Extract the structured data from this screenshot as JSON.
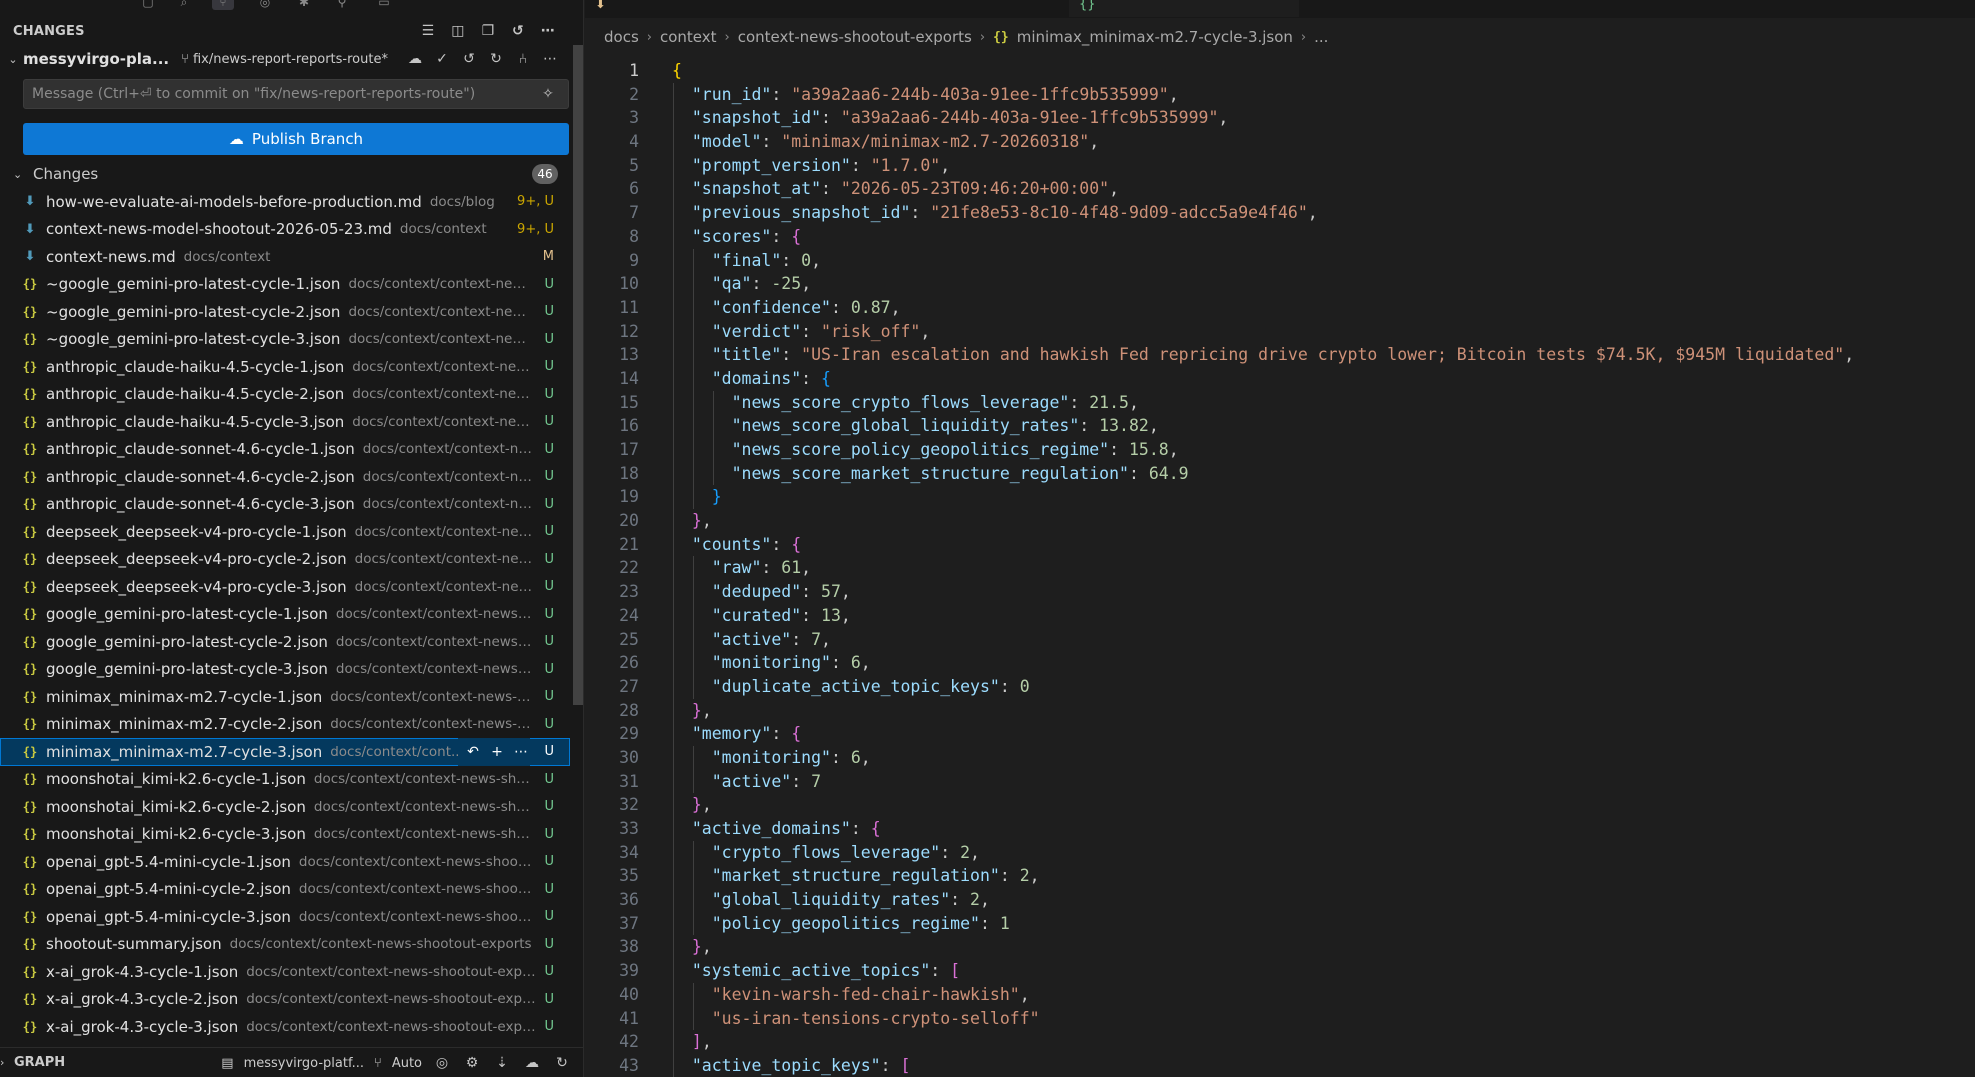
{
  "sidebar": {
    "changes_title": "CHANGES",
    "repo_name": "messyvirgo-pla...",
    "branch": "fix/news-report-reports-route*",
    "commit_placeholder": "Message (Ctrl+⏎ to commit on \"fix/news-report-reports-route\")",
    "publish_label": "Publish Branch",
    "changes_group_label": "Changes",
    "changes_count": "46",
    "files": [
      {
        "name": "how-we-evaluate-ai-models-before-production.md",
        "path": "docs/blog",
        "status": "9+, U",
        "kind": "md"
      },
      {
        "name": "context-news-model-shootout-2026-05-23.md",
        "path": "docs/context",
        "status": "9+, U",
        "kind": "md"
      },
      {
        "name": "context-news.md",
        "path": "docs/context",
        "status": "M",
        "kind": "md"
      },
      {
        "name": "~google_gemini-pro-latest-cycle-1.json",
        "path": "docs/context/context-news...",
        "status": "U",
        "kind": "json"
      },
      {
        "name": "~google_gemini-pro-latest-cycle-2.json",
        "path": "docs/context/context-news...",
        "status": "U",
        "kind": "json"
      },
      {
        "name": "~google_gemini-pro-latest-cycle-3.json",
        "path": "docs/context/context-news...",
        "status": "U",
        "kind": "json"
      },
      {
        "name": "anthropic_claude-haiku-4.5-cycle-1.json",
        "path": "docs/context/context-new...",
        "status": "U",
        "kind": "json"
      },
      {
        "name": "anthropic_claude-haiku-4.5-cycle-2.json",
        "path": "docs/context/context-new...",
        "status": "U",
        "kind": "json"
      },
      {
        "name": "anthropic_claude-haiku-4.5-cycle-3.json",
        "path": "docs/context/context-new...",
        "status": "U",
        "kind": "json"
      },
      {
        "name": "anthropic_claude-sonnet-4.6-cycle-1.json",
        "path": "docs/context/context-ne...",
        "status": "U",
        "kind": "json"
      },
      {
        "name": "anthropic_claude-sonnet-4.6-cycle-2.json",
        "path": "docs/context/context-ne...",
        "status": "U",
        "kind": "json"
      },
      {
        "name": "anthropic_claude-sonnet-4.6-cycle-3.json",
        "path": "docs/context/context-ne...",
        "status": "U",
        "kind": "json"
      },
      {
        "name": "deepseek_deepseek-v4-pro-cycle-1.json",
        "path": "docs/context/context-new...",
        "status": "U",
        "kind": "json"
      },
      {
        "name": "deepseek_deepseek-v4-pro-cycle-2.json",
        "path": "docs/context/context-new...",
        "status": "U",
        "kind": "json"
      },
      {
        "name": "deepseek_deepseek-v4-pro-cycle-3.json",
        "path": "docs/context/context-new...",
        "status": "U",
        "kind": "json"
      },
      {
        "name": "google_gemini-pro-latest-cycle-1.json",
        "path": "docs/context/context-news-s...",
        "status": "U",
        "kind": "json"
      },
      {
        "name": "google_gemini-pro-latest-cycle-2.json",
        "path": "docs/context/context-news-s...",
        "status": "U",
        "kind": "json"
      },
      {
        "name": "google_gemini-pro-latest-cycle-3.json",
        "path": "docs/context/context-news-s...",
        "status": "U",
        "kind": "json"
      },
      {
        "name": "minimax_minimax-m2.7-cycle-1.json",
        "path": "docs/context/context-news-s...",
        "status": "U",
        "kind": "json"
      },
      {
        "name": "minimax_minimax-m2.7-cycle-2.json",
        "path": "docs/context/context-news-s...",
        "status": "U",
        "kind": "json"
      },
      {
        "name": "minimax_minimax-m2.7-cycle-3.json",
        "path": "docs/context/cont...",
        "status": "U",
        "kind": "json",
        "selected": true
      },
      {
        "name": "moonshotai_kimi-k2.6-cycle-1.json",
        "path": "docs/context/context-news-sho...",
        "status": "U",
        "kind": "json"
      },
      {
        "name": "moonshotai_kimi-k2.6-cycle-2.json",
        "path": "docs/context/context-news-sho...",
        "status": "U",
        "kind": "json"
      },
      {
        "name": "moonshotai_kimi-k2.6-cycle-3.json",
        "path": "docs/context/context-news-sho...",
        "status": "U",
        "kind": "json"
      },
      {
        "name": "openai_gpt-5.4-mini-cycle-1.json",
        "path": "docs/context/context-news-shoot...",
        "status": "U",
        "kind": "json"
      },
      {
        "name": "openai_gpt-5.4-mini-cycle-2.json",
        "path": "docs/context/context-news-shoot...",
        "status": "U",
        "kind": "json"
      },
      {
        "name": "openai_gpt-5.4-mini-cycle-3.json",
        "path": "docs/context/context-news-shoot...",
        "status": "U",
        "kind": "json"
      },
      {
        "name": "shootout-summary.json",
        "path": "docs/context/context-news-shootout-exports",
        "status": "U",
        "kind": "json"
      },
      {
        "name": "x-ai_grok-4.3-cycle-1.json",
        "path": "docs/context/context-news-shootout-expo...",
        "status": "U",
        "kind": "json"
      },
      {
        "name": "x-ai_grok-4.3-cycle-2.json",
        "path": "docs/context/context-news-shootout-expo...",
        "status": "U",
        "kind": "json"
      },
      {
        "name": "x-ai_grok-4.3-cycle-3.json",
        "path": "docs/context/context-news-shootout-expo...",
        "status": "U",
        "kind": "json"
      }
    ],
    "graph_title": "GRAPH",
    "graph_repo": "messyvirgo-platf...",
    "graph_auto": "Auto"
  },
  "editor": {
    "breadcrumb": [
      "docs",
      "context",
      "context-news-shootout-exports",
      "minimax_minimax-m2.7-cycle-3.json",
      "..."
    ],
    "code_lines": [
      [
        [
          "b1",
          "{"
        ]
      ],
      [
        [
          "p",
          "  "
        ],
        [
          "k",
          "\"run_id\""
        ],
        [
          "p",
          ": "
        ],
        [
          "s",
          "\"a39a2aa6-244b-403a-91ee-1ffc9b535999\""
        ],
        [
          "p",
          ","
        ]
      ],
      [
        [
          "p",
          "  "
        ],
        [
          "k",
          "\"snapshot_id\""
        ],
        [
          "p",
          ": "
        ],
        [
          "s",
          "\"a39a2aa6-244b-403a-91ee-1ffc9b535999\""
        ],
        [
          "p",
          ","
        ]
      ],
      [
        [
          "p",
          "  "
        ],
        [
          "k",
          "\"model\""
        ],
        [
          "p",
          ": "
        ],
        [
          "s",
          "\"minimax/minimax-m2.7-20260318\""
        ],
        [
          "p",
          ","
        ]
      ],
      [
        [
          "p",
          "  "
        ],
        [
          "k",
          "\"prompt_version\""
        ],
        [
          "p",
          ": "
        ],
        [
          "s",
          "\"1.7.0\""
        ],
        [
          "p",
          ","
        ]
      ],
      [
        [
          "p",
          "  "
        ],
        [
          "k",
          "\"snapshot_at\""
        ],
        [
          "p",
          ": "
        ],
        [
          "s",
          "\"2026-05-23T09:46:20+00:00\""
        ],
        [
          "p",
          ","
        ]
      ],
      [
        [
          "p",
          "  "
        ],
        [
          "k",
          "\"previous_snapshot_id\""
        ],
        [
          "p",
          ": "
        ],
        [
          "s",
          "\"21fe8e53-8c10-4f48-9d09-adcc5a9e4f46\""
        ],
        [
          "p",
          ","
        ]
      ],
      [
        [
          "p",
          "  "
        ],
        [
          "k",
          "\"scores\""
        ],
        [
          "p",
          ": "
        ],
        [
          "b2",
          "{"
        ]
      ],
      [
        [
          "p",
          "    "
        ],
        [
          "k",
          "\"final\""
        ],
        [
          "p",
          ": "
        ],
        [
          "n",
          "0"
        ],
        [
          "p",
          ","
        ]
      ],
      [
        [
          "p",
          "    "
        ],
        [
          "k",
          "\"qa\""
        ],
        [
          "p",
          ": "
        ],
        [
          "n",
          "-25"
        ],
        [
          "p",
          ","
        ]
      ],
      [
        [
          "p",
          "    "
        ],
        [
          "k",
          "\"confidence\""
        ],
        [
          "p",
          ": "
        ],
        [
          "n",
          "0.87"
        ],
        [
          "p",
          ","
        ]
      ],
      [
        [
          "p",
          "    "
        ],
        [
          "k",
          "\"verdict\""
        ],
        [
          "p",
          ": "
        ],
        [
          "s",
          "\"risk_off\""
        ],
        [
          "p",
          ","
        ]
      ],
      [
        [
          "p",
          "    "
        ],
        [
          "k",
          "\"title\""
        ],
        [
          "p",
          ": "
        ],
        [
          "s",
          "\"US-Iran escalation and hawkish Fed repricing drive crypto lower; Bitcoin tests $74.5K, $945M liquidated\""
        ],
        [
          "p",
          ","
        ]
      ],
      [
        [
          "p",
          "    "
        ],
        [
          "k",
          "\"domains\""
        ],
        [
          "p",
          ": "
        ],
        [
          "b3",
          "{"
        ]
      ],
      [
        [
          "p",
          "      "
        ],
        [
          "k",
          "\"news_score_crypto_flows_leverage\""
        ],
        [
          "p",
          ": "
        ],
        [
          "n",
          "21.5"
        ],
        [
          "p",
          ","
        ]
      ],
      [
        [
          "p",
          "      "
        ],
        [
          "k",
          "\"news_score_global_liquidity_rates\""
        ],
        [
          "p",
          ": "
        ],
        [
          "n",
          "13.82"
        ],
        [
          "p",
          ","
        ]
      ],
      [
        [
          "p",
          "      "
        ],
        [
          "k",
          "\"news_score_policy_geopolitics_regime\""
        ],
        [
          "p",
          ": "
        ],
        [
          "n",
          "15.8"
        ],
        [
          "p",
          ","
        ]
      ],
      [
        [
          "p",
          "      "
        ],
        [
          "k",
          "\"news_score_market_structure_regulation\""
        ],
        [
          "p",
          ": "
        ],
        [
          "n",
          "64.9"
        ]
      ],
      [
        [
          "p",
          "    "
        ],
        [
          "b3",
          "}"
        ]
      ],
      [
        [
          "p",
          "  "
        ],
        [
          "b2",
          "}"
        ],
        [
          "p",
          ","
        ]
      ],
      [
        [
          "p",
          "  "
        ],
        [
          "k",
          "\"counts\""
        ],
        [
          "p",
          ": "
        ],
        [
          "b2",
          "{"
        ]
      ],
      [
        [
          "p",
          "    "
        ],
        [
          "k",
          "\"raw\""
        ],
        [
          "p",
          ": "
        ],
        [
          "n",
          "61"
        ],
        [
          "p",
          ","
        ]
      ],
      [
        [
          "p",
          "    "
        ],
        [
          "k",
          "\"deduped\""
        ],
        [
          "p",
          ": "
        ],
        [
          "n",
          "57"
        ],
        [
          "p",
          ","
        ]
      ],
      [
        [
          "p",
          "    "
        ],
        [
          "k",
          "\"curated\""
        ],
        [
          "p",
          ": "
        ],
        [
          "n",
          "13"
        ],
        [
          "p",
          ","
        ]
      ],
      [
        [
          "p",
          "    "
        ],
        [
          "k",
          "\"active\""
        ],
        [
          "p",
          ": "
        ],
        [
          "n",
          "7"
        ],
        [
          "p",
          ","
        ]
      ],
      [
        [
          "p",
          "    "
        ],
        [
          "k",
          "\"monitoring\""
        ],
        [
          "p",
          ": "
        ],
        [
          "n",
          "6"
        ],
        [
          "p",
          ","
        ]
      ],
      [
        [
          "p",
          "    "
        ],
        [
          "k",
          "\"duplicate_active_topic_keys\""
        ],
        [
          "p",
          ": "
        ],
        [
          "n",
          "0"
        ]
      ],
      [
        [
          "p",
          "  "
        ],
        [
          "b2",
          "}"
        ],
        [
          "p",
          ","
        ]
      ],
      [
        [
          "p",
          "  "
        ],
        [
          "k",
          "\"memory\""
        ],
        [
          "p",
          ": "
        ],
        [
          "b2",
          "{"
        ]
      ],
      [
        [
          "p",
          "    "
        ],
        [
          "k",
          "\"monitoring\""
        ],
        [
          "p",
          ": "
        ],
        [
          "n",
          "6"
        ],
        [
          "p",
          ","
        ]
      ],
      [
        [
          "p",
          "    "
        ],
        [
          "k",
          "\"active\""
        ],
        [
          "p",
          ": "
        ],
        [
          "n",
          "7"
        ]
      ],
      [
        [
          "p",
          "  "
        ],
        [
          "b2",
          "}"
        ],
        [
          "p",
          ","
        ]
      ],
      [
        [
          "p",
          "  "
        ],
        [
          "k",
          "\"active_domains\""
        ],
        [
          "p",
          ": "
        ],
        [
          "b2",
          "{"
        ]
      ],
      [
        [
          "p",
          "    "
        ],
        [
          "k",
          "\"crypto_flows_leverage\""
        ],
        [
          "p",
          ": "
        ],
        [
          "n",
          "2"
        ],
        [
          "p",
          ","
        ]
      ],
      [
        [
          "p",
          "    "
        ],
        [
          "k",
          "\"market_structure_regulation\""
        ],
        [
          "p",
          ": "
        ],
        [
          "n",
          "2"
        ],
        [
          "p",
          ","
        ]
      ],
      [
        [
          "p",
          "    "
        ],
        [
          "k",
          "\"global_liquidity_rates\""
        ],
        [
          "p",
          ": "
        ],
        [
          "n",
          "2"
        ],
        [
          "p",
          ","
        ]
      ],
      [
        [
          "p",
          "    "
        ],
        [
          "k",
          "\"policy_geopolitics_regime\""
        ],
        [
          "p",
          ": "
        ],
        [
          "n",
          "1"
        ]
      ],
      [
        [
          "p",
          "  "
        ],
        [
          "b2",
          "}"
        ],
        [
          "p",
          ","
        ]
      ],
      [
        [
          "p",
          "  "
        ],
        [
          "k",
          "\"systemic_active_topics\""
        ],
        [
          "p",
          ": "
        ],
        [
          "b2",
          "["
        ]
      ],
      [
        [
          "p",
          "    "
        ],
        [
          "s",
          "\"kevin-warsh-fed-chair-hawkish\""
        ],
        [
          "p",
          ","
        ]
      ],
      [
        [
          "p",
          "    "
        ],
        [
          "s",
          "\"us-iran-tensions-crypto-selloff\""
        ]
      ],
      [
        [
          "p",
          "  "
        ],
        [
          "b2",
          "]"
        ],
        [
          "p",
          ","
        ]
      ],
      [
        [
          "p",
          "  "
        ],
        [
          "k",
          "\"active_topic_keys\""
        ],
        [
          "p",
          ": "
        ],
        [
          "b2",
          "["
        ]
      ]
    ]
  },
  "colors": {
    "accent": "#0078d4",
    "publish_button": "#0e78d5",
    "untracked": "#73c991",
    "modified": "#e2c08d"
  }
}
